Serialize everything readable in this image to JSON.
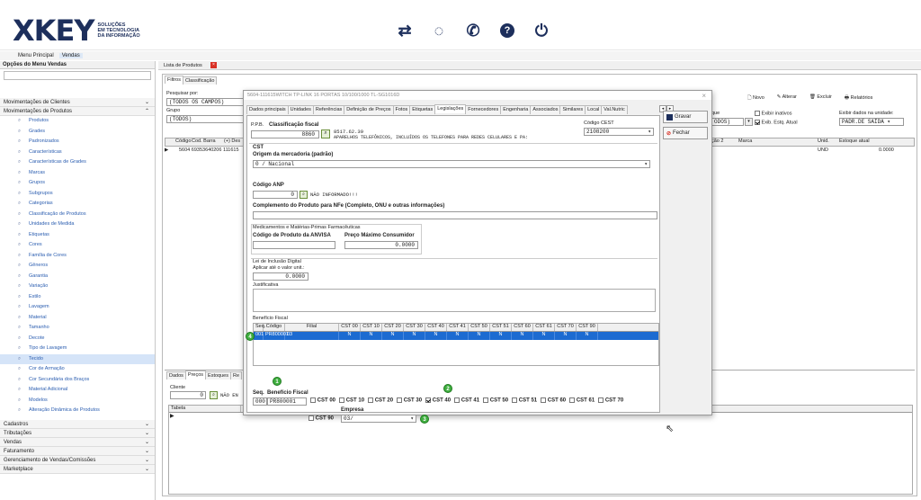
{
  "header": {
    "logo_text": "XKEY",
    "logo_sub": [
      "SOLUÇÕES",
      "EM TECNOLOGIA",
      "DA INFORMAÇÃO"
    ],
    "icons": [
      "shuffle-icon",
      "chat-icon",
      "whatsapp-icon",
      "help-icon",
      "power-icon"
    ]
  },
  "tabs": [
    "Menu Principal",
    "Vendas"
  ],
  "sidebar": {
    "title": "Opções do Menu Vendas",
    "groups_top": [
      "Movimentações de Clientes",
      "Movimentações de Produtos"
    ],
    "items": [
      "Produtos",
      "Grades",
      "Padronizados",
      "Características",
      "Características de Grades",
      "Marcas",
      "Grupos",
      "Subgrupos",
      "Categorias",
      "Classificação de Produtos",
      "Unidades de Medida",
      "Etiquetas",
      "Cores",
      "Família de Cores",
      "Gêneros",
      "Garantia",
      "Variação",
      "Estilo",
      "Lavagem",
      "Material",
      "Tamanho",
      "Decote",
      "Tipo de Lavagem",
      "Tecido",
      "Cor de Armação",
      "Cor Secundária dos Braços",
      "Material Adicional",
      "Modelos",
      "Alteração Dinâmica de Produtos"
    ],
    "selected_item": "Tecido",
    "groups_bottom": [
      "Cadastros",
      "Tributações",
      "Vendas",
      "Faturamento",
      "Gerenciamento de Vendas/Comissões",
      "Marketplace"
    ]
  },
  "list": {
    "title": "Lista de Produtos",
    "filter_tabs": [
      "Filtros",
      "Classificação"
    ],
    "search_label": "Pesquisar por:",
    "search_value": "(TODOS OS CAMPOS)",
    "group_label": "Grupo",
    "group_value": "(TODOS)",
    "estoque_label": "que",
    "estoque_value": "ODOS)",
    "columns": [
      "Código",
      "Cod. Barra",
      "(+) Des"
    ],
    "row": [
      "5604",
      "69353640206",
      "111615"
    ],
    "right_columns": [
      "ção 2",
      "Marca",
      "Unid.",
      "Estoque atual"
    ],
    "right_row": [
      "UND",
      "0.0000"
    ],
    "toolbar": [
      "Novo",
      "Alterar",
      "Excluir",
      "Relatórios"
    ],
    "exibir_inativos": "Exibir inativos",
    "exib_estq": "Exib. Estq. Atual",
    "exibir_dados_label": "Exibir dados na unidade:",
    "exibir_dados_value": "PADR.DE SAÍDA",
    "bottom_tabs": [
      "Dados",
      "Preços",
      "Estoques",
      "Re"
    ],
    "cliente_label": "Cliente",
    "cliente_value": "0",
    "cliente_text": "NÃO EN",
    "table_cols": [
      "Tabela",
      "Unidade",
      "Descrição da Unidade",
      "Preço",
      "Desconto",
      "Preço Mínimo",
      "Preço Unitário",
      "Validade",
      "Promoção",
      "Validade"
    ]
  },
  "modal": {
    "title": "5604-111615WITCH TP-LINK 16 PORTAS 10/100/1000 TL-SG1016D",
    "tabs": [
      "Dados principais",
      "Unidades",
      "Referências",
      "Definição de Preços",
      "Fotos",
      "Etiquetas",
      "Legislações",
      "Fornecedores",
      "Engenharia",
      "Associados",
      "Similares",
      "Local",
      "Val.Nutric"
    ],
    "active_tab": "Legislações",
    "btn_gravar": "Gravar",
    "btn_fechar": "Fechar",
    "ppb_label": "P.P.B.",
    "classif_label": "Classificação fiscal",
    "classif_value": "8860",
    "ncm_code": "8517.62.39",
    "ncm_desc": "APARELHOS TELEFÔNICOS, INCLUÍDOS OS TELEFONES PARA REDES CELULARES E PA:",
    "cest_label": "Código CEST",
    "cest_value": "2108200",
    "cst_title": "CST",
    "origem_label": "Origem da mercadoria (padrão)",
    "origem_value": "0 / Nacional",
    "anp_label": "Código ANP",
    "anp_value": "0",
    "anp_text": "NÃO INFORMADO!!!",
    "complemento_label": "Complemento do Produto para NFe (Completo, ONU e outras informações)",
    "med_title": "Medicamentos e Matérias-Primas Farmacêuticas",
    "anvisa_label": "Código de Produto da ANVISA",
    "pmc_label": "Preço Máximo Consumidor",
    "pmc_value": "0.0000",
    "lei_title": "Lei de Inclusão Digital",
    "aplicar_label": "Aplicar até o valor unit.:",
    "aplicar_value": "0.0000",
    "justificativa_label": "Justificativa",
    "beneficio_title": "Benefício Fiscal",
    "bf_cols": [
      "Seq.",
      "Código",
      "Filial",
      "CST 00",
      "CST 10",
      "CST 20",
      "CST 30",
      "CST 40",
      "CST 41",
      "CST 50",
      "CST 51",
      "CST 60",
      "CST 61",
      "CST 70",
      "CST 90"
    ],
    "bf_row": [
      "001",
      "PR800001",
      "03",
      "N",
      "N",
      "N",
      "N",
      "N",
      "N",
      "N",
      "N",
      "N",
      "N",
      "N",
      "N"
    ],
    "seq_label": "Seq.",
    "seq_value": "000",
    "bf_label": "Benefício Fiscal",
    "bf_value": "PR800001",
    "cst_checks": [
      "CST 00",
      "CST 10",
      "CST 20",
      "CST 30",
      "CST 40",
      "CST 41",
      "CST 50",
      "CST 51",
      "CST 60",
      "CST 61",
      "CST 70"
    ],
    "cst_checked": "CST 40",
    "cst90": "CST 90",
    "empresa_label": "Empresa",
    "empresa_value": "03/",
    "markers": [
      "1",
      "2",
      "3",
      "4"
    ]
  }
}
